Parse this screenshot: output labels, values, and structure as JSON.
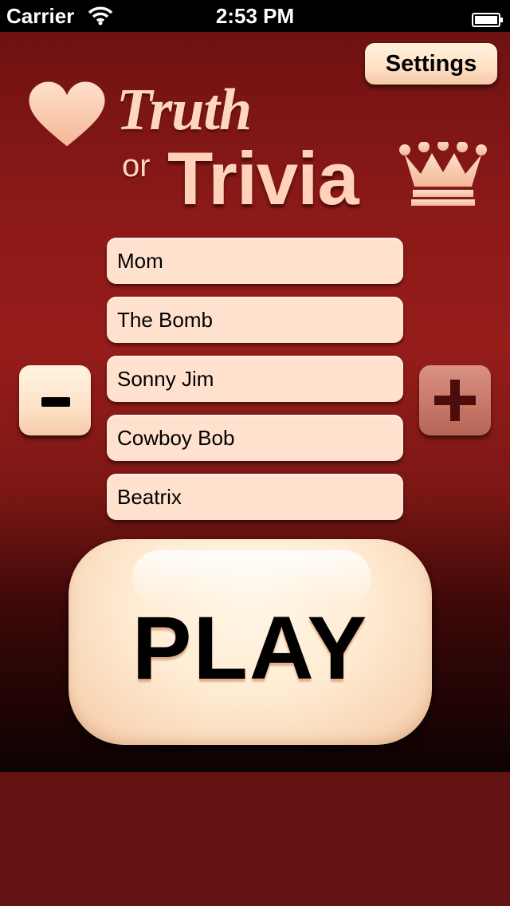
{
  "status_bar": {
    "carrier": "Carrier",
    "time": "2:53 PM",
    "wifi_icon": "wifi-icon",
    "battery_icon": "battery-icon"
  },
  "header": {
    "settings_label": "Settings"
  },
  "logo": {
    "truth": "Truth",
    "or": "or",
    "trivia": "Trivia",
    "heart_icon": "heart-icon",
    "crown_icon": "crown-icon"
  },
  "players": [
    "Mom",
    "The Bomb",
    "Sonny Jim",
    "Cowboy Bob",
    "Beatrix"
  ],
  "controls": {
    "minus_icon": "minus-icon",
    "plus_icon": "plus-icon",
    "play_label": "PLAY"
  },
  "colors": {
    "background_dark": "#641313",
    "accent_red": "#961d1a",
    "button_cream": "#ffe1cd",
    "plus_button": "#c77666"
  }
}
